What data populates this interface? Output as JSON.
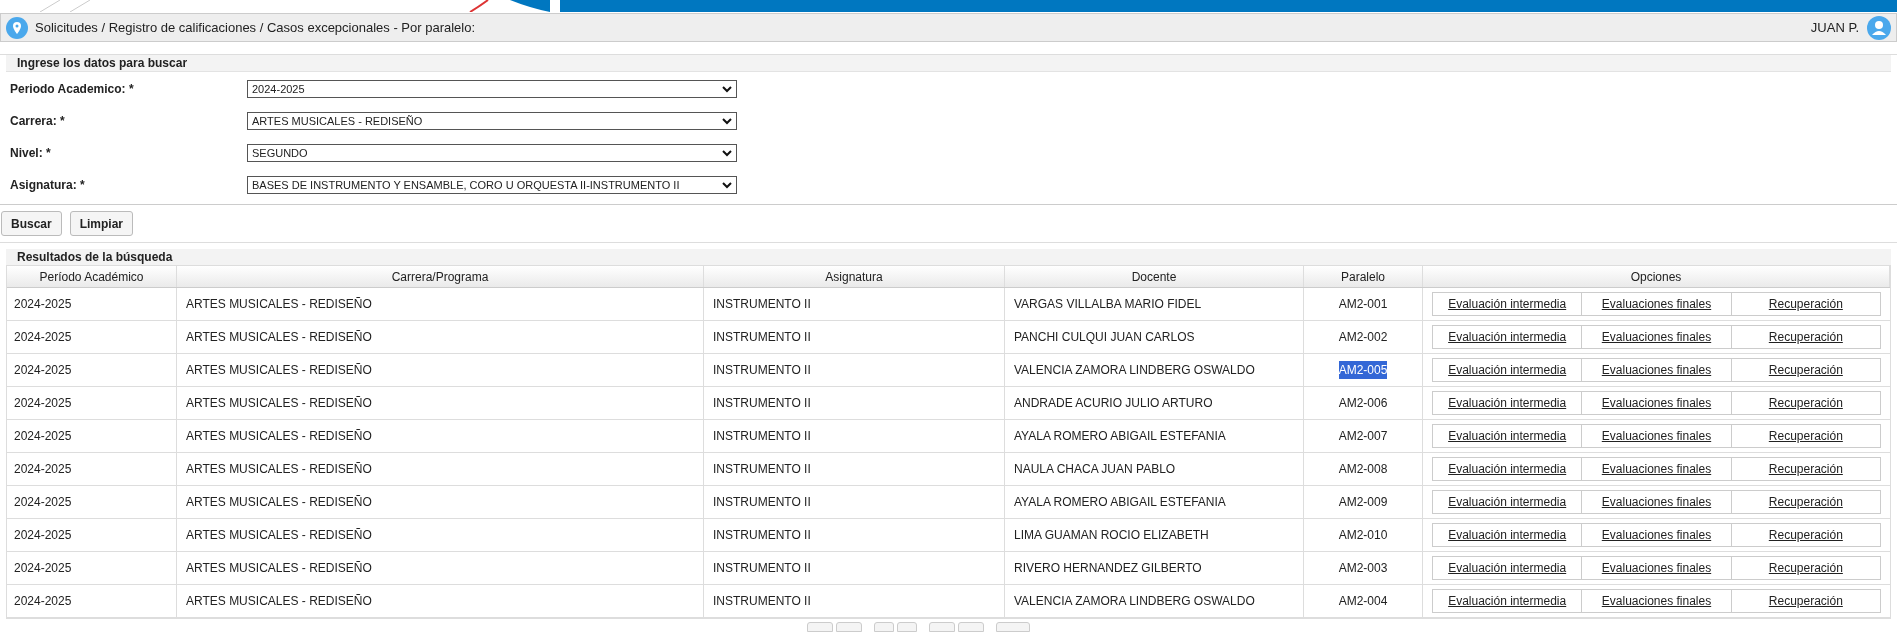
{
  "breadcrumb": "Solicitudes / Registro de calificaciones / Casos excepcionales - Por paralelo:",
  "user": {
    "name": "JUAN P."
  },
  "search_form": {
    "title": "Ingrese los datos para buscar",
    "fields": [
      {
        "label": "Periodo Academico: *",
        "value": "2024-2025"
      },
      {
        "label": "Carrera: *",
        "value": "ARTES MUSICALES - REDISEÑO"
      },
      {
        "label": "Nivel: *",
        "value": "SEGUNDO"
      },
      {
        "label": "Asignatura: *",
        "value": "BASES DE INSTRUMENTO Y ENSAMBLE, CORO U ORQUESTA II-INSTRUMENTO II"
      }
    ],
    "buttons": [
      "Buscar",
      "Limpiar"
    ]
  },
  "results": {
    "title": "Resultados de la búsqueda",
    "columns": [
      "Período Académico",
      "Carrera/Programa",
      "Asignatura",
      "Docente",
      "Paralelo",
      "Opciones"
    ],
    "rows": [
      {
        "periodo": "2024-2025",
        "carrera": "ARTES MUSICALES - REDISEÑO",
        "asignatura": "INSTRUMENTO II",
        "docente": "VARGAS VILLALBA MARIO FIDEL",
        "paralelo": "AM2-001",
        "highlighted": false,
        "options": [
          "Evaluación intermedia",
          "Evaluaciones finales",
          "Recuperación"
        ]
      },
      {
        "periodo": "2024-2025",
        "carrera": "ARTES MUSICALES - REDISEÑO",
        "asignatura": "INSTRUMENTO II",
        "docente": "PANCHI CULQUI JUAN CARLOS",
        "paralelo": "AM2-002",
        "highlighted": false,
        "options": [
          "Evaluación intermedia",
          "Evaluaciones finales",
          "Recuperación"
        ]
      },
      {
        "periodo": "2024-2025",
        "carrera": "ARTES MUSICALES - REDISEÑO",
        "asignatura": "INSTRUMENTO II",
        "docente": "VALENCIA ZAMORA LINDBERG OSWALDO",
        "paralelo": "AM2-005",
        "highlighted": true,
        "options": [
          "Evaluación intermedia",
          "Evaluaciones finales",
          "Recuperación"
        ]
      },
      {
        "periodo": "2024-2025",
        "carrera": "ARTES MUSICALES - REDISEÑO",
        "asignatura": "INSTRUMENTO II",
        "docente": "ANDRADE ACURIO JULIO ARTURO",
        "paralelo": "AM2-006",
        "highlighted": false,
        "options": [
          "Evaluación intermedia",
          "Evaluaciones finales",
          "Recuperación"
        ]
      },
      {
        "periodo": "2024-2025",
        "carrera": "ARTES MUSICALES - REDISEÑO",
        "asignatura": "INSTRUMENTO II",
        "docente": "AYALA ROMERO ABIGAIL ESTEFANIA",
        "paralelo": "AM2-007",
        "highlighted": false,
        "options": [
          "Evaluación intermedia",
          "Evaluaciones finales",
          "Recuperación"
        ]
      },
      {
        "periodo": "2024-2025",
        "carrera": "ARTES MUSICALES - REDISEÑO",
        "asignatura": "INSTRUMENTO II",
        "docente": "NAULA CHACA JUAN PABLO",
        "paralelo": "AM2-008",
        "highlighted": false,
        "options": [
          "Evaluación intermedia",
          "Evaluaciones finales",
          "Recuperación"
        ]
      },
      {
        "periodo": "2024-2025",
        "carrera": "ARTES MUSICALES - REDISEÑO",
        "asignatura": "INSTRUMENTO II",
        "docente": "AYALA ROMERO ABIGAIL ESTEFANIA",
        "paralelo": "AM2-009",
        "highlighted": false,
        "options": [
          "Evaluación intermedia",
          "Evaluaciones finales",
          "Recuperación"
        ]
      },
      {
        "periodo": "2024-2025",
        "carrera": "ARTES MUSICALES - REDISEÑO",
        "asignatura": "INSTRUMENTO II",
        "docente": "LIMA GUAMAN ROCIO ELIZABETH",
        "paralelo": "AM2-010",
        "highlighted": false,
        "options": [
          "Evaluación intermedia",
          "Evaluaciones finales",
          "Recuperación"
        ]
      },
      {
        "periodo": "2024-2025",
        "carrera": "ARTES MUSICALES - REDISEÑO",
        "asignatura": "INSTRUMENTO II",
        "docente": "RIVERO HERNANDEZ GILBERTO",
        "paralelo": "AM2-003",
        "highlighted": false,
        "options": [
          "Evaluación intermedia",
          "Evaluaciones finales",
          "Recuperación"
        ]
      },
      {
        "periodo": "2024-2025",
        "carrera": "ARTES MUSICALES - REDISEÑO",
        "asignatura": "INSTRUMENTO II",
        "docente": "VALENCIA ZAMORA LINDBERG OSWALDO",
        "paralelo": "AM2-004",
        "highlighted": false,
        "options": [
          "Evaluación intermedia",
          "Evaluaciones finales",
          "Recuperación"
        ]
      }
    ]
  }
}
